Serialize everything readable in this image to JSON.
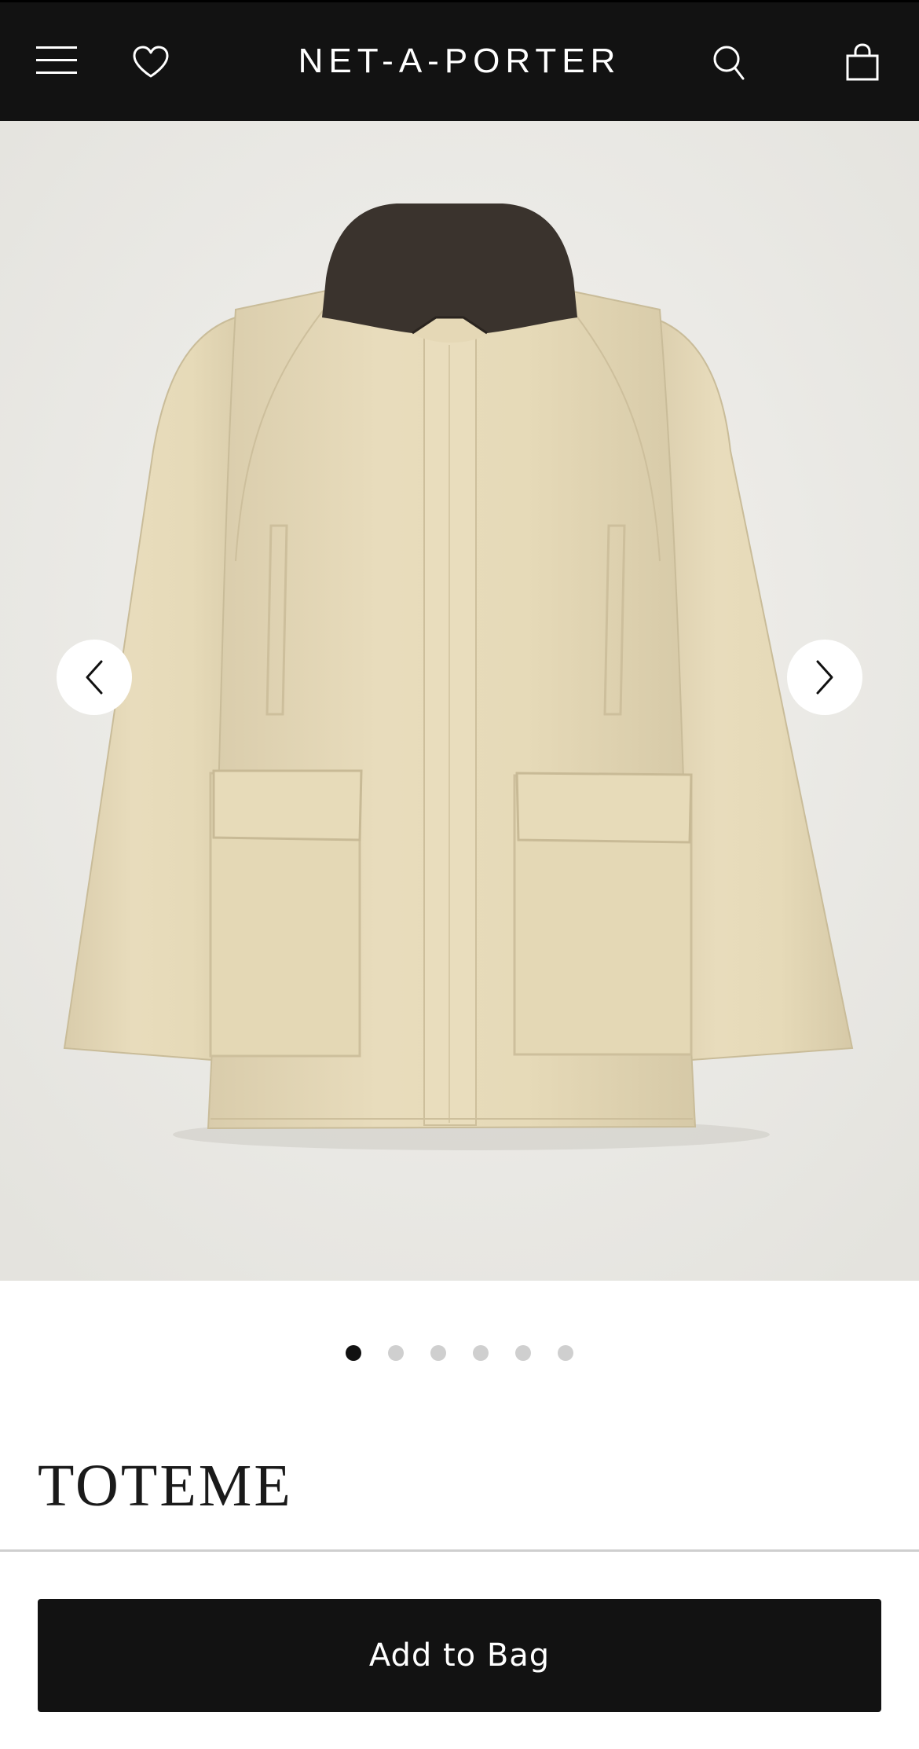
{
  "header": {
    "brand": "NET-A-PORTER",
    "icons": [
      "menu-icon",
      "heart-icon",
      "search-icon",
      "bag-icon"
    ]
  },
  "gallery": {
    "image": "product-jacket-image",
    "total_images": 6,
    "active_index": 0,
    "prev_icon": "chevron-left-icon",
    "next_icon": "chevron-right-icon"
  },
  "product": {
    "designer": "TOTEME"
  },
  "cta": {
    "add_to_bag": "Add to Bag"
  },
  "colors": {
    "header_bg": "#121212",
    "accent": "#121212",
    "jacket": "#e6dab8",
    "collar": "#3a332d"
  }
}
